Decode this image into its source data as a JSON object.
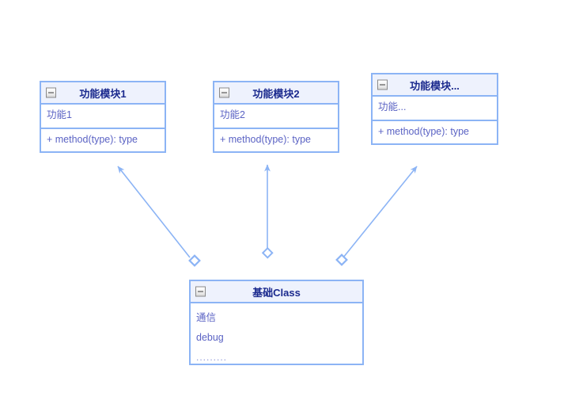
{
  "diagram": {
    "type": "uml-class-diagram",
    "colors": {
      "border": "#8cb4f5",
      "header_background": "#eef2fd",
      "title_text": "#1b2a8e",
      "body_text": "#5b63c4",
      "connector": "#8cb4f5",
      "canvas_background": "#ffffff"
    },
    "classes": [
      {
        "id": "module1",
        "title": "功能模块1",
        "collapse_icon": "minus-square-icon",
        "attributes": [
          "功能1"
        ],
        "methods": [
          "+ method(type): type"
        ]
      },
      {
        "id": "module2",
        "title": "功能模块2",
        "collapse_icon": "minus-square-icon",
        "attributes": [
          "功能2"
        ],
        "methods": [
          "+ method(type): type"
        ]
      },
      {
        "id": "module3",
        "title": "功能模块...",
        "collapse_icon": "minus-square-icon",
        "attributes": [
          "功能..."
        ],
        "methods": [
          "+ method(type): type"
        ]
      },
      {
        "id": "base",
        "title": "基础Class",
        "collapse_icon": "minus-square-icon",
        "attributes": [
          "通信",
          "debug",
          "........."
        ],
        "methods": []
      }
    ],
    "connectors": [
      {
        "id": "base-to-module1",
        "kind": "aggregation-arrow",
        "source": "base",
        "target": "module1",
        "source_marker": "hollow-diamond",
        "target_marker": "open-arrow"
      },
      {
        "id": "base-to-module2",
        "kind": "aggregation-arrow",
        "source": "base",
        "target": "module2",
        "source_marker": "hollow-diamond",
        "target_marker": "open-arrow"
      },
      {
        "id": "base-to-module3",
        "kind": "aggregation-arrow",
        "source": "base",
        "target": "module3",
        "source_marker": "hollow-diamond",
        "target_marker": "open-arrow"
      }
    ]
  }
}
